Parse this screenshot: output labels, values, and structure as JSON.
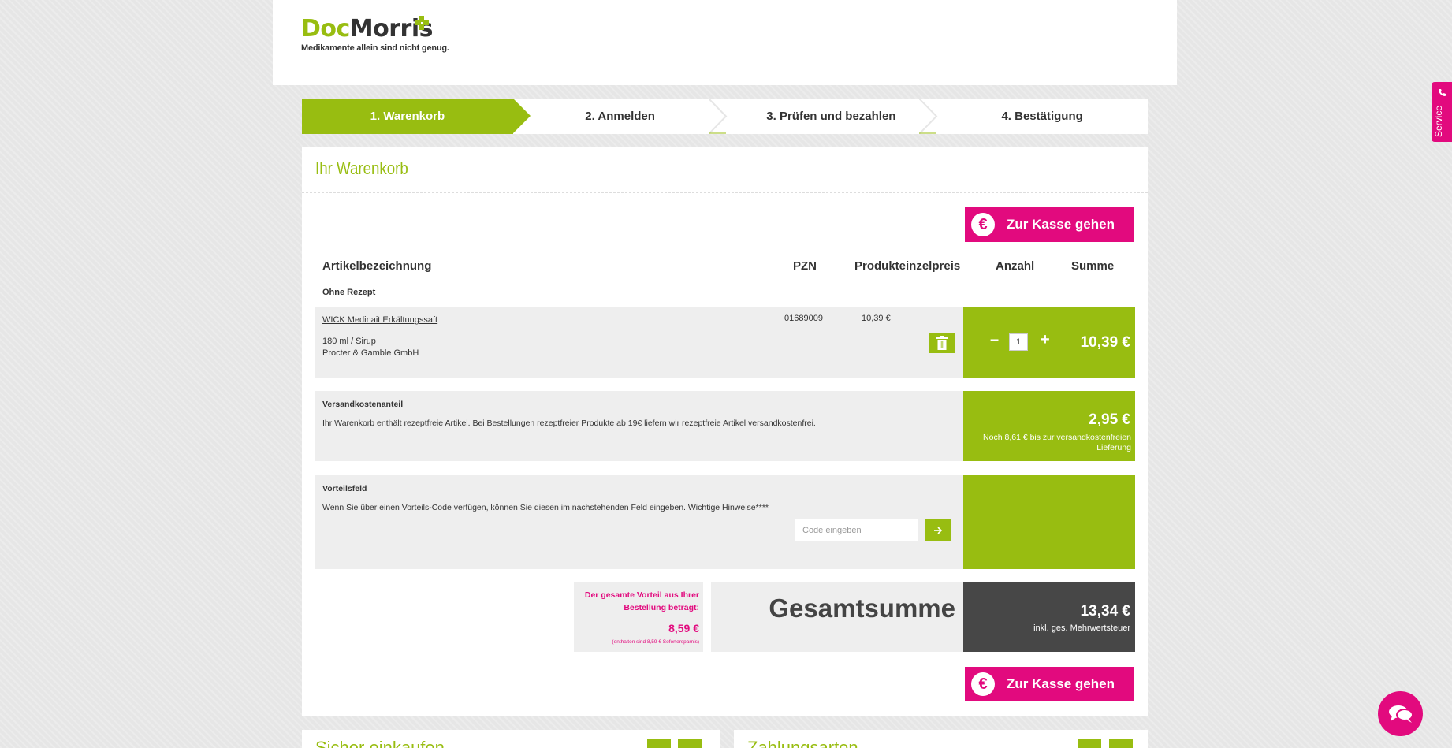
{
  "logo": {
    "brand_part1": "Doc",
    "brand_part2": "Morris",
    "tagline": "Medikamente allein sind nicht genug."
  },
  "steps": [
    {
      "label": "1. Warenkorb",
      "active": true
    },
    {
      "label": "2. Anmelden",
      "active": false
    },
    {
      "label": "3. Prüfen und bezahlen",
      "active": false
    },
    {
      "label": "4. Bestätigung",
      "active": false
    }
  ],
  "cart": {
    "title": "Ihr Warenkorb",
    "checkout_label": "Zur Kasse gehen",
    "columns": {
      "article": "Artikelbezeichnung",
      "pzn": "PZN",
      "unit_price": "Produkteinzelpreis",
      "quantity": "Anzahl",
      "sum": "Summe"
    },
    "section_label": "Ohne Rezept",
    "product": {
      "name": "WICK Medinait Erkältungssaft",
      "size": "180 ml / Sirup",
      "manufacturer": "Procter & Gamble GmbH",
      "pzn": "01689009",
      "unit_price": "10,39 €",
      "quantity": "1",
      "sum": "10,39 €"
    },
    "shipping": {
      "title": "Versandkostenanteil",
      "text": "Ihr Warenkorb enthält rezeptfreie Artikel. Bei Bestellungen rezeptfreier Produkte ab 19€ liefern wir rezeptfreie Artikel versandkostenfrei.",
      "price": "2,95 €",
      "note": "Noch 8,61 € bis zur versandkostenfreien Lieferung"
    },
    "voucher": {
      "title": "Vorteilsfeld",
      "text": "Wenn Sie über einen Vorteils-Code verfügen, können Sie diesen im nachstehenden Feld eingeben. Wichtige Hinweise****",
      "placeholder": "Code eingeben"
    },
    "savings": {
      "label": "Der gesamte Vorteil aus Ihrer Bestellung beträgt:",
      "amount": "8,59 €",
      "note": "(enthalten sind 8,59 € Sofortersparnis)"
    },
    "total": {
      "label": "Gesamtsumme",
      "amount": "13,34 €",
      "tax_note": "inkl. ges. Mehrwertsteuer"
    }
  },
  "bottom": {
    "left_title": "Sicher einkaufen",
    "right_title": "Zahlungsarten"
  },
  "service": {
    "label": "Service"
  },
  "colors": {
    "accent": "#98bd11",
    "brand": "#e20a7e",
    "dark": "#474747"
  }
}
